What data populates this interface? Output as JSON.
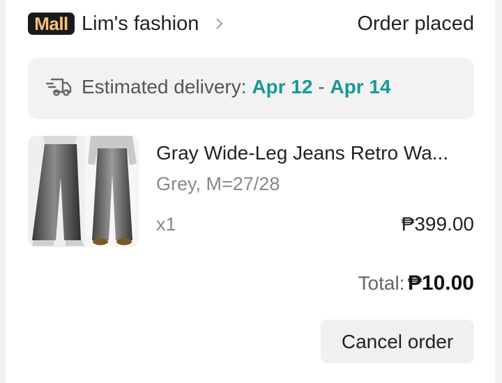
{
  "header": {
    "mall_badge": "Mall",
    "shop_name": "Lim's fashion",
    "order_status": "Order placed"
  },
  "delivery": {
    "label": "Estimated delivery:",
    "start_date": "Apr 12",
    "separator": "-",
    "end_date": "Apr 14",
    "icon": "truck-icon"
  },
  "product": {
    "title": "Gray Wide-Leg Jeans Retro Wa...",
    "variant": "Grey, M=27/28",
    "quantity": "x1",
    "price": "₱399.00",
    "image_icon": "product-thumbnail"
  },
  "summary": {
    "total_label": "Total:",
    "total_value": "₱10.00"
  },
  "actions": {
    "cancel_label": "Cancel order"
  },
  "colors": {
    "accent_teal": "#159a93",
    "mall_badge_bg": "#1a1a1a",
    "mall_badge_text": "#f5c07a",
    "panel_bg": "#f2f2f2"
  }
}
